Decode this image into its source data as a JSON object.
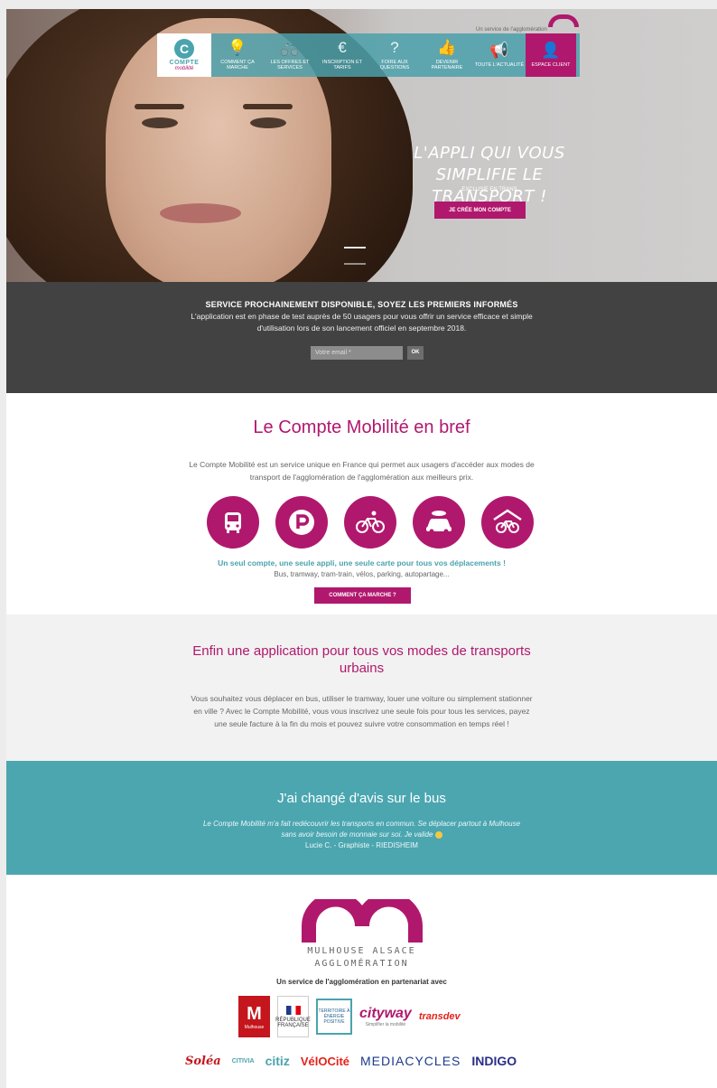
{
  "hero": {
    "top_service": "Un service de l'agglomération",
    "nav": [
      {
        "label": "COMMENT ÇA MARCHE",
        "icon": "lightbulb-icon",
        "glyph": "💡"
      },
      {
        "label": "LES OFFRES ET SERVICES",
        "icon": "bicycle-icon",
        "glyph": "🚲"
      },
      {
        "label": "INSCRIPTION ET TARIFS",
        "icon": "euro-icon",
        "glyph": "€"
      },
      {
        "label": "FOIRE AUX QUESTIONS",
        "icon": "question-icon",
        "glyph": "?"
      },
      {
        "label": "DEVENIR PARTENAIRE",
        "icon": "thumbs-up-icon",
        "glyph": "👍"
      },
      {
        "label": "TOUTE L'ACTUALITÉ",
        "icon": "megaphone-icon",
        "glyph": "📢"
      },
      {
        "label": "ESPACE CLIENT",
        "icon": "user-icon",
        "glyph": "👤"
      }
    ],
    "logo": {
      "title": "COMPTE",
      "subtitle": "mobilité",
      "letter": "C"
    },
    "tagline": "L'APPLI QUI VOUS SIMPLIFIE LE TRANSPORT !",
    "tagline_sub": "EXCLUSIF EN TRANS",
    "cta": "JE CRÉE MON COMPTE"
  },
  "newsletter": {
    "title": "SERVICE PROCHAINEMENT DISPONIBLE, SOYEZ LES PREMIERS INFORMÉS",
    "text": "L'application est en phase de test auprès de 50 usagers pour vous offrir un service efficace et simple d'utilisation lors de son lancement officiel en septembre 2018.",
    "placeholder": "Votre email *",
    "ok": "OK"
  },
  "bref": {
    "title": "Le Compte Mobilité en bref",
    "text": "Le Compte Mobilité est un service unique en France qui permet aux usagers d'accéder aux modes de transport de l'agglomération de l'agglomération aux meilleurs prix.",
    "icons": [
      "bus-icon",
      "parking-icon",
      "bicycle-icon",
      "car-sharing-icon",
      "bike-shelter-icon"
    ],
    "strong": "Un seul compte, une seule appli, une seule carte pour tous vos déplacements !",
    "small": "Bus, tramway, tram-train, vélos, parking, autopartage...",
    "button": "COMMENT ÇA MARCHE ?"
  },
  "app": {
    "title": "Enfin une application pour tous vos modes de transports urbains",
    "text": "Vous souhaitez vous déplacer en bus, utiliser le tramway, louer une voiture ou simplement stationner en ville ? Avec le Compte Mobilité, vous vous inscrivez une seule fois pour tous les services, payez une seule facture à la fin du mois et pouvez suivre votre consommation en temps réel !"
  },
  "testimonial": {
    "title": "J'ai changé d'avis sur le bus",
    "quote": "Le Compte Mobilité m'a fait redécouvrir les transports en commun. Se déplacer partout à Mulhouse sans avoir besoin de monnaie sur soi. Je valide",
    "author": "Lucie C. - Graphiste - RIEDISHEIM"
  },
  "footer": {
    "org_line1": "MULHOUSE ALSACE",
    "org_line2": "AGGLOMÉRATION",
    "partner_text": "Un service de l'agglomération en partenariat avec",
    "partners_row1": {
      "mulhouse": "M",
      "mulhouse_label": "Mulhouse",
      "rf": "RÉPUBLIQUE FRANÇAISE",
      "territoire": "TERRITOIRE À ÉNERGIE POSITIVE",
      "cityway": "cityway",
      "cityway_sub": "Simplifier la mobilité",
      "transdev": "transdev"
    },
    "partners_row2": {
      "soleo": "Soléa",
      "citiva": "CITIVIA",
      "citiz": "citiz",
      "velocite": "VélOCité",
      "mediacycles": "MEDIACYCLES",
      "indigo": "INDIGO"
    }
  },
  "colors": {
    "brand": "#b0186d",
    "teal": "#4ba6b0",
    "dark": "#424242"
  }
}
